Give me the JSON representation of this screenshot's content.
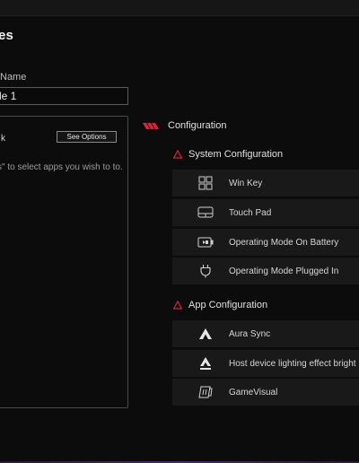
{
  "page": {
    "title": "es"
  },
  "profile": {
    "name_label": "Name",
    "name_value": "le 1"
  },
  "panel": {
    "heading": "k",
    "see_options_label": "See Options",
    "description": "s\" to select apps you wish to to."
  },
  "configuration": {
    "title": "Configuration",
    "system": {
      "title": "System Configuration",
      "items": [
        {
          "label": "Win Key",
          "icon": "win-key-icon"
        },
        {
          "label": "Touch Pad",
          "icon": "touchpad-icon"
        },
        {
          "label": "Operating Mode On Battery",
          "icon": "battery-icon"
        },
        {
          "label": "Operating Mode Plugged In",
          "icon": "plug-icon"
        }
      ]
    },
    "app": {
      "title": "App Configuration",
      "items": [
        {
          "label": "Aura Sync",
          "icon": "aura-sync-icon"
        },
        {
          "label": "Host device lighting effect bright",
          "icon": "aura-bright-icon"
        },
        {
          "label": "GameVisual",
          "icon": "gamevisual-icon"
        }
      ]
    }
  },
  "colors": {
    "accent": "#e0203a",
    "background": "#0c0c0d",
    "row": "#191919"
  }
}
